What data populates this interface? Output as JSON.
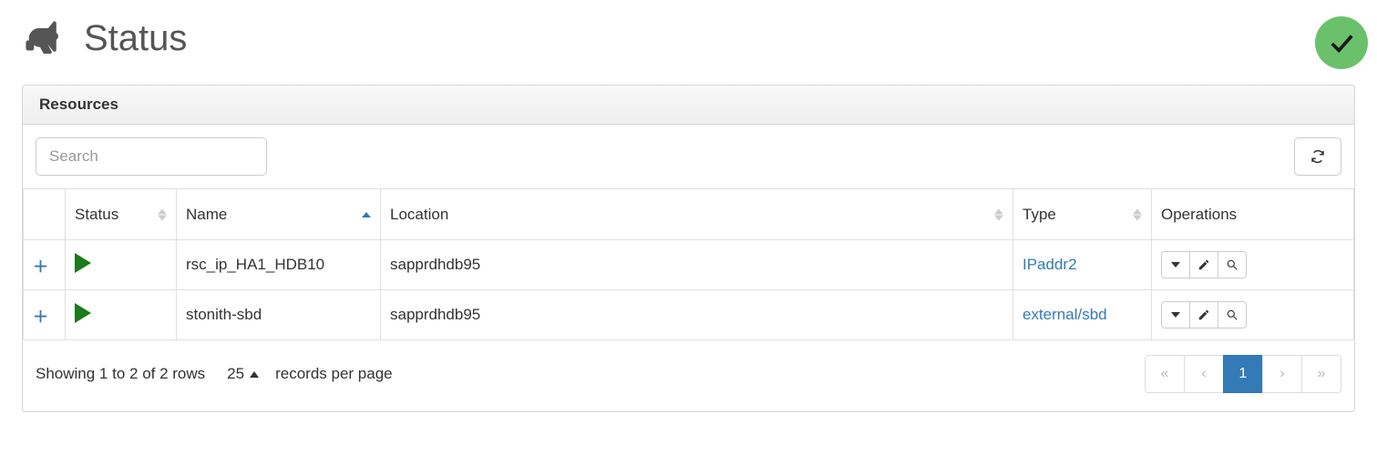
{
  "header": {
    "title": "Status"
  },
  "panel": {
    "title": "Resources"
  },
  "search": {
    "placeholder": "Search"
  },
  "columns": {
    "status": "Status",
    "name": "Name",
    "location": "Location",
    "type": "Type",
    "operations": "Operations"
  },
  "rows": [
    {
      "name": "rsc_ip_HA1_HDB10",
      "location": "sapprdhdb95",
      "type": "IPaddr2"
    },
    {
      "name": "stonith-sbd",
      "location": "sapprdhdb95",
      "type": "external/sbd"
    }
  ],
  "footer": {
    "showing": "Showing 1 to 2 of 2 rows",
    "page_size": "25",
    "records_label": "records per page"
  },
  "pagination": {
    "first": "«",
    "prev": "‹",
    "current": "1",
    "next": "›",
    "last": "»"
  }
}
